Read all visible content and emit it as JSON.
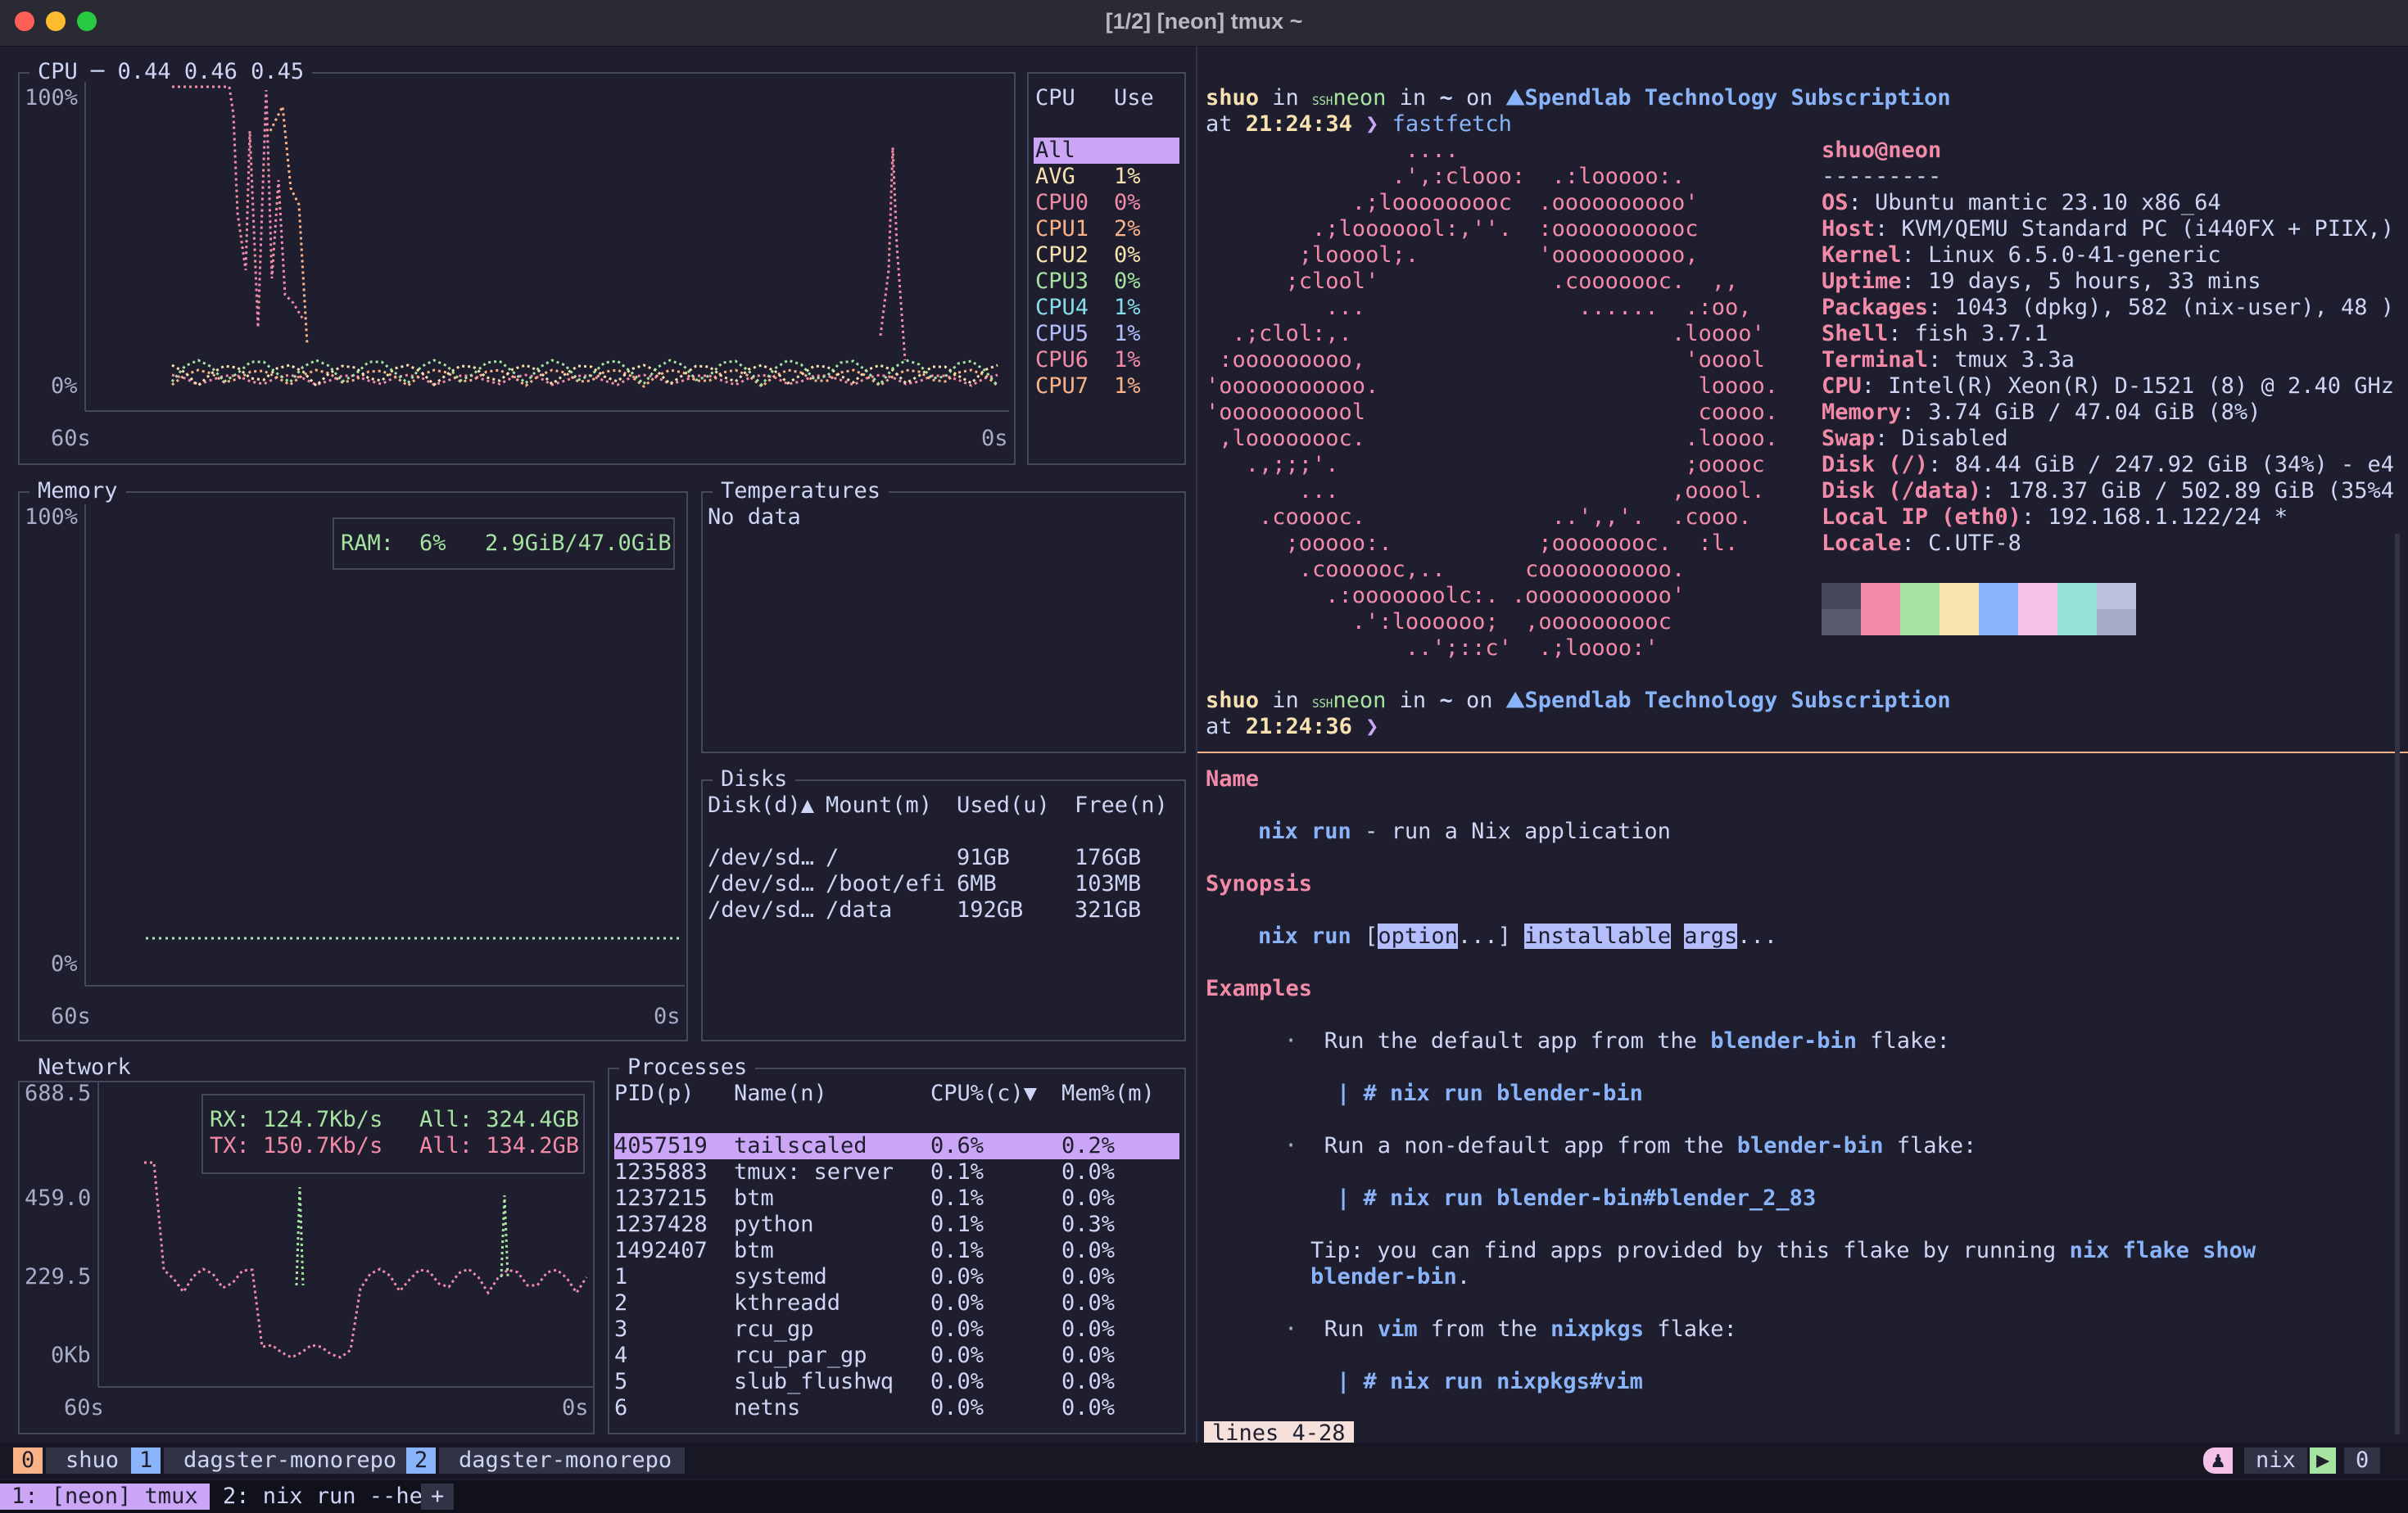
{
  "window": {
    "title": "[1/2] [neon] tmux ~"
  },
  "cpu": {
    "title": "CPU",
    "load": "─ 0.44 0.46 0.45",
    "y_top": "100%",
    "y_bottom": "0%",
    "x_left": "60s",
    "x_right": "0s",
    "legend_headers": [
      "CPU",
      "Use"
    ],
    "legend": [
      {
        "name": "All",
        "use": "",
        "color": "#cba6f7"
      },
      {
        "name": "AVG",
        "use": "1%",
        "color": "#f9e2af"
      },
      {
        "name": "CPU0",
        "use": "0%",
        "color": "#f38ba8"
      },
      {
        "name": "CPU1",
        "use": "2%",
        "color": "#fab387"
      },
      {
        "name": "CPU2",
        "use": "0%",
        "color": "#f9e2af"
      },
      {
        "name": "CPU3",
        "use": "0%",
        "color": "#a6e3a1"
      },
      {
        "name": "CPU4",
        "use": "1%",
        "color": "#89dceb"
      },
      {
        "name": "CPU5",
        "use": "1%",
        "color": "#b4befe"
      },
      {
        "name": "CPU6",
        "use": "1%",
        "color": "#f38ba8"
      },
      {
        "name": "CPU7",
        "use": "1%",
        "color": "#fab387"
      }
    ]
  },
  "memory": {
    "title": "Memory",
    "y_top": "100%",
    "y_bottom": "0%",
    "x_left": "60s",
    "x_right": "0s",
    "ram_label": "RAM:",
    "ram_pct": "6%",
    "ram_val": "2.9GiB/47.0GiB"
  },
  "temps": {
    "title": "Temperatures",
    "text": "No data"
  },
  "disks": {
    "title": "Disks",
    "headers": [
      "Disk(d)▲",
      "Mount(m)",
      "Used(u)",
      "Free(n)"
    ],
    "rows": [
      [
        "/dev/sd…",
        "/",
        "91GB",
        "176GB"
      ],
      [
        "/dev/sd…",
        "/boot/efi",
        "6MB",
        "103MB"
      ],
      [
        "/dev/sd…",
        "/data",
        "192GB",
        "321GB"
      ]
    ]
  },
  "network": {
    "title": "Network",
    "y_ticks": [
      "688.5",
      "459.0",
      "229.5",
      "0Kb"
    ],
    "x_left": "60s",
    "x_right": "0s",
    "rx_label": "RX: 124.7Kb/s",
    "rx_all": "All: 324.4GB",
    "tx_label": "TX: 150.7Kb/s",
    "tx_all": "All: 134.2GB"
  },
  "processes": {
    "title": "Processes",
    "headers": [
      "PID(p)",
      "Name(n)",
      "CPU%(c)▼",
      "Mem%(m)"
    ],
    "rows": [
      [
        "4057519",
        "tailscaled",
        "0.6%",
        "0.2%"
      ],
      [
        "1235883",
        "tmux: server",
        "0.1%",
        "0.0%"
      ],
      [
        "1237215",
        "btm",
        "0.1%",
        "0.0%"
      ],
      [
        "1237428",
        "python",
        "0.1%",
        "0.3%"
      ],
      [
        "1492407",
        "btm",
        "0.1%",
        "0.0%"
      ],
      [
        "1",
        "systemd",
        "0.0%",
        "0.0%"
      ],
      [
        "2",
        "kthreadd",
        "0.0%",
        "0.0%"
      ],
      [
        "3",
        "rcu_gp",
        "0.0%",
        "0.0%"
      ],
      [
        "4",
        "rcu_par_gp",
        "0.0%",
        "0.0%"
      ],
      [
        "5",
        "slub_flushwq",
        "0.0%",
        "0.0%"
      ],
      [
        "6",
        "netns",
        "0.0%",
        "0.0%"
      ]
    ]
  },
  "prompt1": {
    "user": "shuo",
    "in": "in",
    "ssh": "SSH",
    "host": "neon",
    "in2": "in",
    "dir": "~",
    "on": "on",
    "project": "Spendlab Technology Subscription",
    "at": "at",
    "time": "21:24:34",
    "arrow": "❯",
    "cmd": "fastfetch"
  },
  "fastfetch": {
    "ascii": [
      "               ....",
      "              .',:clooo:  .:looooo:.",
      "           .;looooooooc  .oooooooooo'",
      "        .;looooool:,''.  :ooooooooooc",
      "       ;looool;.         'oooooooooo,",
      "      ;clool'             .cooooooc.  ,,",
      "         ...                ......  .:oo,",
      "  .;clol:,.                        .loooo'",
      " :ooooooooo,                        'ooool",
      "'ooooooooooo.                        loooo.",
      "'ooooooooool                         coooo.",
      " ,loooooooc.                        .loooo.",
      "   .,;;;'.                          ;ooooc",
      "       ...                         ,ooool.",
      "    .cooooc.              ..',,'.  .cooo.",
      "      ;ooooo:.           ;oooooooc.  :l.",
      "       .coooooc,..      coooooooooo.",
      "         .:ooooooolc:. .ooooooooooo'",
      "           .':loooooo;  ,oooooooooc",
      "               ..';::c'  .;loooo:'"
    ],
    "userhost": "shuo@neon",
    "sep": "---------",
    "info": [
      {
        "k": "OS",
        "v": "Ubuntu mantic 23.10 x86_64"
      },
      {
        "k": "Host",
        "v": "KVM/QEMU Standard PC (i440FX + PIIX,)"
      },
      {
        "k": "Kernel",
        "v": "Linux 6.5.0-41-generic"
      },
      {
        "k": "Uptime",
        "v": "19 days, 5 hours, 33 mins"
      },
      {
        "k": "Packages",
        "v": "1043 (dpkg), 582 (nix-user), 48 )"
      },
      {
        "k": "Shell",
        "v": "fish 3.7.1"
      },
      {
        "k": "Terminal",
        "v": "tmux 3.3a"
      },
      {
        "k": "CPU",
        "v": "Intel(R) Xeon(R) D-1521 (8) @ 2.40 GHz"
      },
      {
        "k": "Memory",
        "v": "3.74 GiB / 47.04 GiB (8%)"
      },
      {
        "k": "Swap",
        "v": "Disabled"
      },
      {
        "k": "Disk (/)",
        "v": "84.44 GiB / 247.92 GiB (34%) - e4"
      },
      {
        "k": "Disk (/data)",
        "v": "178.37 GiB / 502.89 GiB (35%4"
      },
      {
        "k": "Local IP (eth0)",
        "v": "192.168.1.122/24 *"
      },
      {
        "k": "Locale",
        "v": "C.UTF-8"
      }
    ],
    "swatches_top": [
      "#45475a",
      "#f38ba8",
      "#a6e3a1",
      "#f9e2af",
      "#89b4fa",
      "#f5c2e7",
      "#94e2d5",
      "#bac2de"
    ],
    "swatches_bottom": [
      "#585b70",
      "#f38ba8",
      "#a6e3a1",
      "#f9e2af",
      "#89b4fa",
      "#f5c2e7",
      "#94e2d5",
      "#a6adc8"
    ]
  },
  "prompt2": {
    "user": "shuo",
    "in": "in",
    "ssh": "SSH",
    "host": "neon",
    "in2": "in",
    "dir": "~",
    "on": "on",
    "project": "Spendlab Technology Subscription",
    "at": "at",
    "time": "21:24:36",
    "arrow": "❯"
  },
  "man": {
    "name_hdr": "Name",
    "name_cmd": "nix run",
    "name_desc": " - run a Nix application",
    "syn_hdr": "Synopsis",
    "syn_cmd": "nix run",
    "syn_lb": " [",
    "syn_opt": "option",
    "syn_mid": "...] ",
    "syn_inst": "installable",
    "syn_sp": " ",
    "syn_args": "args",
    "syn_end": "...",
    "ex_hdr": "Examples",
    "bullet": "·",
    "ex1_a": "Run the default app from the ",
    "ex1_b": "blender-bin",
    "ex1_c": " flake:",
    "ex1_code": "| # nix run blender-bin",
    "ex2_a": "Run a non-default app from the ",
    "ex2_b": "blender-bin",
    "ex2_c": " flake:",
    "ex2_code": "| # nix run blender-bin#blender_2_83",
    "tip_a": "Tip: you can find apps provided by this flake by running ",
    "tip_b": "nix flake show",
    "tip_c": "blender-bin",
    "tip_d": ".",
    "ex3_a": "Run ",
    "ex3_b": "vim",
    "ex3_c": " from the ",
    "ex3_d": "nixpkgs",
    "ex3_e": " flake:",
    "ex3_code": "| # nix run nixpkgs#vim",
    "pager": "lines 4-28"
  },
  "status": {
    "win0_idx": "0",
    "win0_name": "shuo",
    "win1_idx": "1",
    "win1_name": "dagster-monorepo",
    "win2_idx": "2",
    "win2_name": "dagster-monorepo",
    "right_env": "nix",
    "right_count": "0"
  },
  "tabs": {
    "tab1": "1: [neon] tmux",
    "tab2": "2: nix run --he",
    "plus": "+"
  }
}
